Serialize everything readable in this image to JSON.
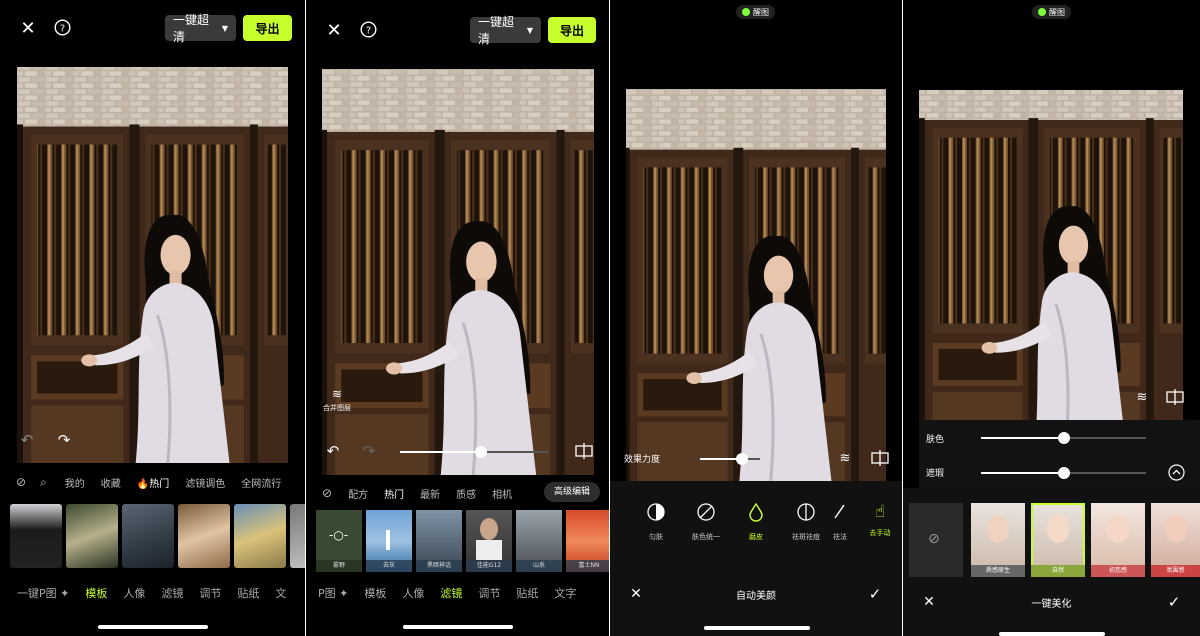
{
  "colors": {
    "accent": "#c6ff2b",
    "panel_bg": "#000000",
    "muted": "#aaaaaa"
  },
  "common": {
    "quality_label": "一键超清",
    "export_label": "导出",
    "merge_layers": "合并图层",
    "watermark": "醒图"
  },
  "panel1": {
    "chips": [
      "我的",
      "收藏",
      "🔥热门",
      "滤镜调色",
      "全网流行"
    ],
    "nav": [
      "一键P图 ✦",
      "模板",
      "人像",
      "滤镜",
      "调节",
      "贴纸",
      "文"
    ],
    "active_nav_index": 1
  },
  "panel2": {
    "chips": [
      "配方",
      "热门",
      "最新",
      "质感",
      "相机"
    ],
    "advanced": "高级编辑",
    "filters": [
      "雾野",
      "去灰",
      "黑暗神话",
      "佳能G12",
      "山系",
      "富士NN"
    ],
    "nav": [
      "P图 ✦",
      "模板",
      "人像",
      "滤镜",
      "调节",
      "贴纸",
      "文字"
    ],
    "active_nav_index": 3,
    "slider_value": 0.55
  },
  "panel3": {
    "strength_label": "效果力度",
    "strength_value": 0.7,
    "tools": [
      "匀肤",
      "肤色统一",
      "磨皮",
      "祛斑祛痘",
      "祛法",
      "去手动"
    ],
    "active_tool_index": 2,
    "title": "自动美颜"
  },
  "panel4": {
    "sliders": [
      {
        "label": "肤色",
        "value": 0.5
      },
      {
        "label": "遮瑕",
        "value": 0.5
      }
    ],
    "presets": [
      "原始",
      "质感原生",
      "自然",
      "初恋感",
      "氛围感"
    ],
    "active_preset_index": 2,
    "title": "一键美化"
  }
}
